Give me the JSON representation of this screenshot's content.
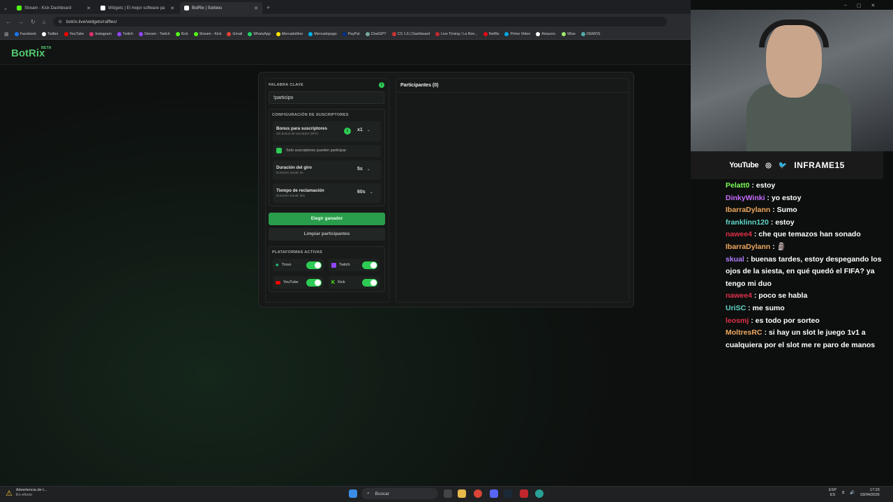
{
  "browser": {
    "tabs": [
      {
        "title": "Stream - Kick Dashboard",
        "color": "#53fc18"
      },
      {
        "title": "Widgets | El mejor software pa",
        "color": "#ffffff"
      },
      {
        "title": "BotRix | Sorteos",
        "color": "#ffffff",
        "active": true
      }
    ],
    "url": "botrix.live/widgets/raffles/",
    "bookmarks": [
      "Facebook",
      "Twitter",
      "YouTube",
      "Instagram",
      "Twitch",
      "Stream - Twitch",
      "Kick",
      "Stream - Kick",
      "Gmail",
      "WhatsApp",
      "Mercadolibre",
      "Mercadopago",
      "PayPal",
      "ChatGPT",
      "CS 1.6 | Dashboard",
      "Live Timing / La Ron...",
      "Netflix",
      "Prime Video",
      "Amazon.",
      "Wise",
      "DEMOS"
    ]
  },
  "app": {
    "logo": "BotRix",
    "beta": "BETA"
  },
  "raffle": {
    "keyword_label": "PALABRA CLAVE",
    "keyword_value": "!participo",
    "subs_section": "CONFIGURACIÓN DE SUSCRIPTORES",
    "bonus_title": "Bonus para suscriptores",
    "bonus_sub": "Sin bonus de suscriptor (OFF)",
    "bonus_value": "x1",
    "subs_only": "Solo suscriptores pueden participar",
    "duration_title": "Duración del giro",
    "duration_sub": "Duración actual: 5s",
    "duration_value": "5s",
    "claim_title": "Tiempo de reclamación",
    "claim_sub": "Duración actual: 60s",
    "claim_value": "60s",
    "pick_winner": "Elegir ganador",
    "clear": "Limpiar participantes",
    "platforms_label": "PLATAFORMAS ACTIVAS",
    "platforms": [
      {
        "name": "Trovo",
        "color": "#1ec97e"
      },
      {
        "name": "Twitch",
        "color": "#9146ff"
      },
      {
        "name": "YouTube",
        "color": "#ff0000"
      },
      {
        "name": "Kick",
        "color": "#53fc18"
      }
    ],
    "participants": "Participantes (0)"
  },
  "overlay": {
    "brand": "INFRAME15",
    "youtube": "YouTube",
    "chat": [
      {
        "user": "Pelatt0",
        "color": "#7cfc5a",
        "text": ": estoy"
      },
      {
        "user": "DinkyWinki",
        "color": "#c86cff",
        "text": ": yo estoy"
      },
      {
        "user": "IbarraDylann",
        "color": "#f0a860",
        "text": ": Sumo"
      },
      {
        "user": "franklinn120",
        "color": "#5fd6c8",
        "text": ": estoy"
      },
      {
        "user": "nawee4",
        "color": "#e0304a",
        "text": ": che que temazos han sonado"
      },
      {
        "user": "IbarraDylann",
        "color": "#f0a860",
        "text": ": 🗿"
      },
      {
        "user": "skual",
        "color": "#b07cff",
        "text": ": buenas tardes, estoy despegando los ojos de la siesta, en qué quedó el FIFA? ya tengo mi duo"
      },
      {
        "user": "nawee4",
        "color": "#e0304a",
        "text": ": poco se habla"
      },
      {
        "user": "UriSC",
        "color": "#5fd6c8",
        "text": ": me sumo"
      },
      {
        "user": "leosmj",
        "color": "#e0304a",
        "text": ": es todo por sorteo"
      },
      {
        "user": "MoltresRC",
        "color": "#f0a860",
        "text": ": si hay un slot le juego 1v1 a cualquiera por el slot me re paro de manos"
      }
    ]
  },
  "taskbar": {
    "search": "Buscar",
    "warning_title": "Advertencia de t...",
    "warning_sub": "En efecto",
    "lang1": "ESP",
    "lang2": "ES",
    "time": "17:23",
    "date": "03/04/2026"
  }
}
